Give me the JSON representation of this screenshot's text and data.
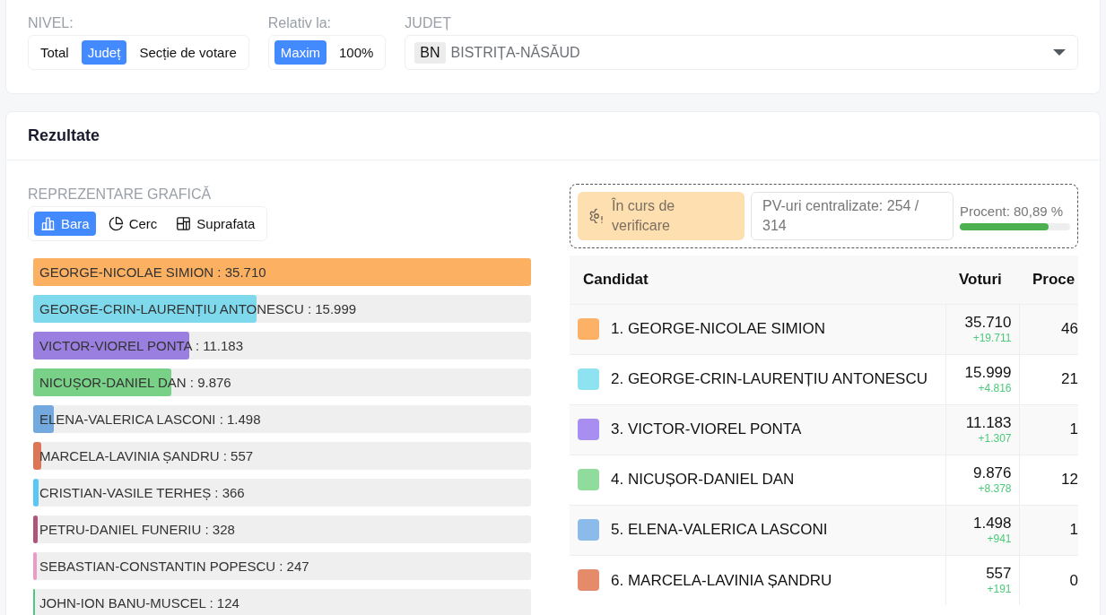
{
  "filters": [
    {
      "label": "NIVEL:",
      "options": [
        {
          "label": "Total",
          "selected": false
        },
        {
          "label": "Județ",
          "selected": true
        },
        {
          "label": "Secție de votare",
          "selected": false
        }
      ]
    },
    {
      "label": "Relativ la:",
      "options": [
        {
          "label": "Maxim",
          "selected": true
        },
        {
          "label": "100%",
          "selected": false
        }
      ]
    }
  ],
  "county": {
    "label": "JUDEȚ",
    "code": "BN",
    "value": "BISTRIȚA-NĂSĂUD"
  },
  "results": {
    "title": "Rezultate",
    "chart_panel": {
      "label": "REPREZENTARE GRAFICĂ",
      "views": [
        {
          "label": "Bara",
          "kind": "bar",
          "selected": true
        },
        {
          "label": "Cerc",
          "kind": "pie",
          "selected": false
        },
        {
          "label": "Suprafata",
          "kind": "area",
          "selected": false
        }
      ],
      "bars": [
        {
          "label": "GEORGE-NICOLAE SIMION : 35.710",
          "level": 1,
          "color": "#fcb062"
        },
        {
          "label": "GEORGE-CRIN-LAURENȚIU ANTONESCU : 15.999",
          "level": 0.448,
          "color": "#7fd9ec"
        },
        {
          "label": "VICTOR-VIOREL PONTA : 11.183",
          "level": 0.313,
          "color": "#9a7fe0"
        },
        {
          "label": "NICUȘOR-DANIEL DAN : 9.876",
          "level": 0.277,
          "color": "#79d087"
        },
        {
          "label": "ELENA-VALERICA LASCONI : 1.498",
          "level": 0.042,
          "color": "#73a9de"
        },
        {
          "label": "MARCELA-LAVINIA ȘANDRU : 557",
          "level": 0.016,
          "color": "#dd7656"
        },
        {
          "label": "CRISTIAN-VASILE TERHEȘ : 366",
          "level": 0.01,
          "color": "#58c7f3"
        },
        {
          "label": "PETRU-DANIEL FUNERIU : 328",
          "level": 0.009,
          "color": "#b0557a"
        },
        {
          "label": "SEBASTIAN-CONSTANTIN POPESCU : 247",
          "level": 0.007,
          "color": "#ea9cc8"
        },
        {
          "label": "JOHN-ION BANU-MUSCEL : 124",
          "level": 0.0035,
          "color": "#4fc97f"
        }
      ]
    },
    "status": {
      "label": "În curs de verificare",
      "reports": "PV-uri centralizate: 254 / 314",
      "percent": "Procent: 80,89 %",
      "level": 0.8089
    },
    "table": {
      "columns": [
        "Candidat",
        "Voturi",
        "Proce"
      ],
      "rows": [
        {
          "name": "1. GEORGE-NICOLAE SIMION",
          "color": "#fbb267",
          "votes": "35.710",
          "change": "+19.711",
          "percent": "46"
        },
        {
          "name": "2. GEORGE-CRIN-LAURENȚIU ANTONESCU",
          "color": "#8fe3f0",
          "votes": "15.999",
          "change": "+4.816",
          "percent": "21"
        },
        {
          "name": "3. VICTOR-VIOREL PONTA",
          "color": "#a78ef0",
          "votes": "11.183",
          "change": "+1.307",
          "percent": "1"
        },
        {
          "name": "4. NICUȘOR-DANIEL DAN",
          "color": "#90dc9c",
          "votes": "9.876",
          "change": "+8.378",
          "percent": "12"
        },
        {
          "name": "5. ELENA-VALERICA LASCONI",
          "color": "#8cbbea",
          "votes": "1.498",
          "change": "+941",
          "percent": "1"
        },
        {
          "name": "6. MARCELA-LAVINIA ȘANDRU",
          "color": "#e68a6c",
          "votes": "557",
          "change": "+191",
          "percent": "0"
        }
      ]
    }
  }
}
